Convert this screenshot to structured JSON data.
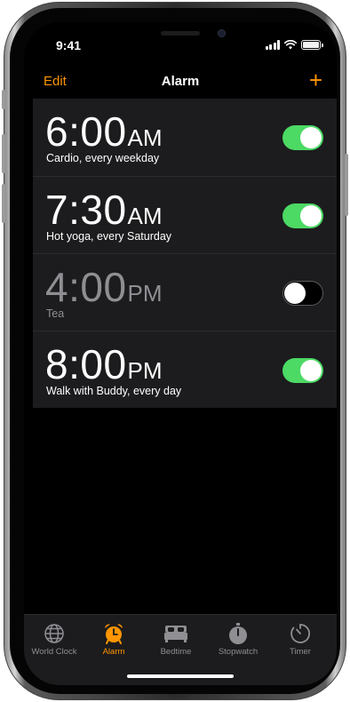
{
  "status_bar": {
    "time": "9:41"
  },
  "nav": {
    "edit_label": "Edit",
    "title": "Alarm",
    "add_label": "+"
  },
  "alarms": [
    {
      "time": "6:00",
      "period": "AM",
      "label": "Cardio, every weekday",
      "enabled": true
    },
    {
      "time": "7:30",
      "period": "AM",
      "label": "Hot yoga, every Saturday",
      "enabled": true
    },
    {
      "time": "4:00",
      "period": "PM",
      "label": "Tea",
      "enabled": false
    },
    {
      "time": "8:00",
      "period": "PM",
      "label": "Walk with Buddy, every day",
      "enabled": true
    }
  ],
  "tabs": [
    {
      "label": "World Clock",
      "icon": "globe-icon",
      "active": false
    },
    {
      "label": "Alarm",
      "icon": "alarm-clock-icon",
      "active": true
    },
    {
      "label": "Bedtime",
      "icon": "bed-icon",
      "active": false
    },
    {
      "label": "Stopwatch",
      "icon": "stopwatch-icon",
      "active": false
    },
    {
      "label": "Timer",
      "icon": "timer-icon",
      "active": false
    }
  ],
  "colors": {
    "accent": "#ff9500",
    "toggle_on": "#4cd964",
    "row_bg": "#1c1c1e",
    "inactive": "#8e8e93"
  }
}
